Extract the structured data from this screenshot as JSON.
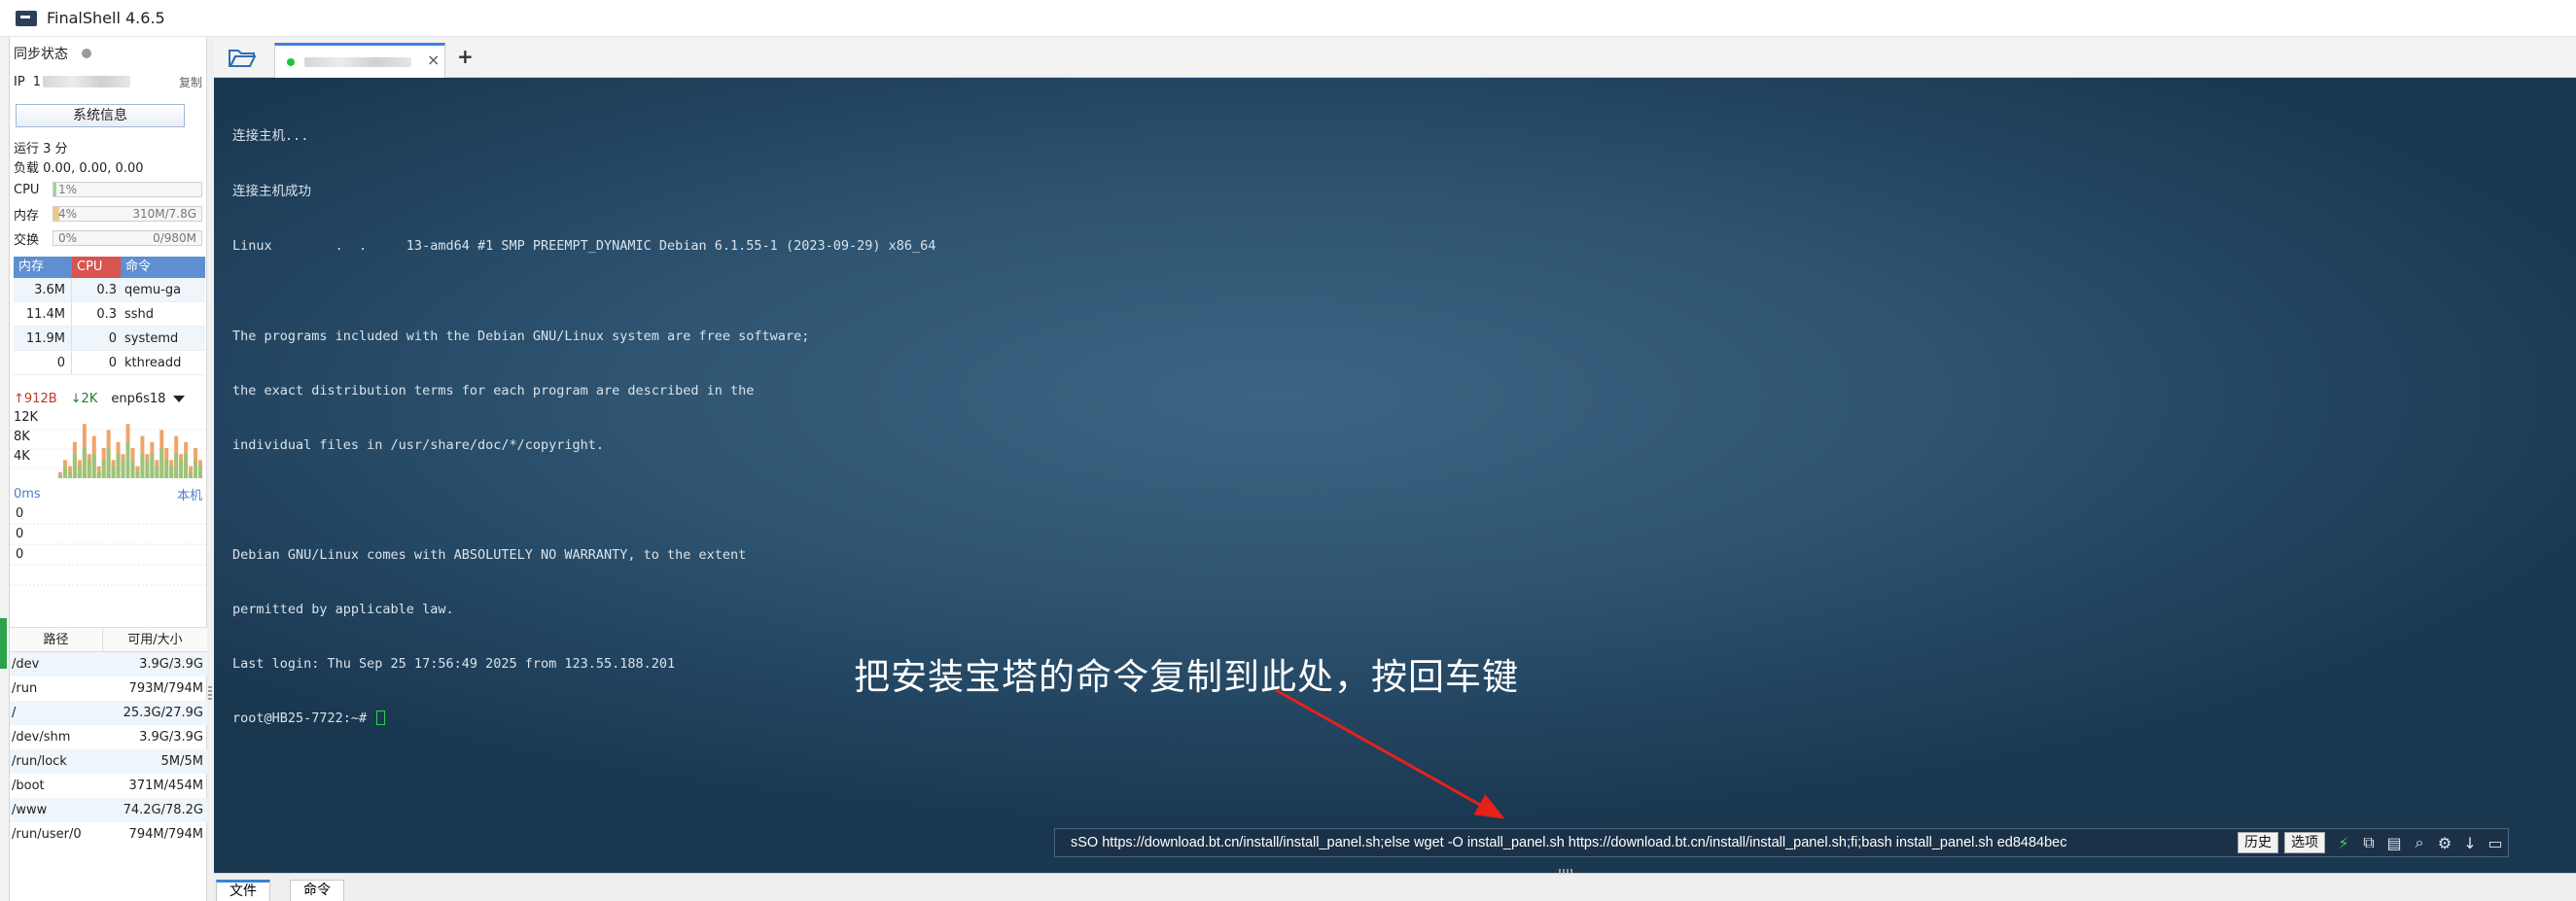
{
  "window": {
    "title": "FinalShell 4.6.5"
  },
  "sidebar": {
    "sync_label": "同步状态",
    "ip_label": "IP",
    "ip_value": "1",
    "copy_label": "复制",
    "sysinfo_button": "系统信息",
    "uptime": "运行 3 分",
    "load": "负载 0.00, 0.00, 0.00",
    "cpu": {
      "label": "CPU",
      "percent_text": "1%",
      "level": 0.01
    },
    "memory": {
      "label": "内存",
      "percent_text": "4%",
      "usage": "310M/7.8G",
      "level": 0.04
    },
    "swap": {
      "label": "交换",
      "percent_text": "0%",
      "usage": "0/980M",
      "level": 0.0
    },
    "process_headers": {
      "mem": "内存",
      "cpu": "CPU",
      "cmd": "命令"
    },
    "processes": [
      {
        "mem": "3.6M",
        "cpu": "0.3",
        "cmd": "qemu-ga"
      },
      {
        "mem": "11.4M",
        "cpu": "0.3",
        "cmd": "sshd"
      },
      {
        "mem": "11.9M",
        "cpu": "0",
        "cmd": "systemd"
      },
      {
        "mem": "0",
        "cpu": "0",
        "cmd": "kthreadd"
      }
    ],
    "network": {
      "up": "912B",
      "down": "2K",
      "interface": "enp6s18",
      "axis_labels": [
        "12K",
        "8K",
        "4K"
      ],
      "up_bars": [
        0.1,
        0.3,
        0.2,
        0.6,
        0.3,
        0.9,
        0.4,
        0.7,
        0.2,
        0.5,
        0.8,
        0.3,
        0.6,
        0.4,
        0.9,
        0.5,
        0.2,
        0.7,
        0.4,
        0.6,
        0.3,
        0.8,
        0.5,
        0.3,
        0.7,
        0.4,
        0.6,
        0.2,
        0.5,
        0.3
      ],
      "down_bars": [
        0.05,
        0.2,
        0.1,
        0.4,
        0.2,
        0.5,
        0.3,
        0.4,
        0.1,
        0.3,
        0.5,
        0.2,
        0.4,
        0.3,
        0.6,
        0.3,
        0.1,
        0.4,
        0.3,
        0.4,
        0.2,
        0.5,
        0.3,
        0.2,
        0.4,
        0.3,
        0.4,
        0.1,
        0.3,
        0.2
      ]
    },
    "ping": {
      "ms_label": "0ms",
      "local_label": "本机",
      "axis_labels": [
        "0",
        "0",
        "0"
      ]
    },
    "disk_headers": {
      "path": "路径",
      "size": "可用/大小"
    },
    "disks": [
      {
        "path": "/dev",
        "size": "3.9G/3.9G"
      },
      {
        "path": "/run",
        "size": "793M/794M"
      },
      {
        "path": "/",
        "size": "25.3G/27.9G"
      },
      {
        "path": "/dev/shm",
        "size": "3.9G/3.9G"
      },
      {
        "path": "/run/lock",
        "size": "5M/5M"
      },
      {
        "path": "/boot",
        "size": "371M/454M"
      },
      {
        "path": "/www",
        "size": "74.2G/78.2G"
      },
      {
        "path": "/run/user/0",
        "size": "794M/794M"
      }
    ]
  },
  "tabs": {
    "close_glyph": "×",
    "add_glyph": "+"
  },
  "terminal": {
    "lines": [
      "连接主机...",
      "连接主机成功",
      "Linux        .  .     13-amd64 #1 SMP PREEMPT_DYNAMIC Debian 6.1.55-1 (2023-09-29) x86_64",
      "",
      "The programs included with the Debian GNU/Linux system are free software;",
      "the exact distribution terms for each program are described in the",
      "individual files in /usr/share/doc/*/copyright.",
      "",
      "Debian GNU/Linux comes with ABSOLUTELY NO WARRANTY, to the extent",
      "permitted by applicable law.",
      "Last login: Thu Sep 25 17:56:49 2025 from 123.55.188.201"
    ],
    "prompt": "root@HB25-7722:~# ",
    "annotation": "把安装宝塔的命令复制到此处，按回车键",
    "annotation_arrow_color": "#e8201a"
  },
  "command_bar": {
    "value": "sSO https://download.bt.cn/install/install_panel.sh;else wget -O install_panel.sh https://download.bt.cn/install/install_panel.sh;fi;bash install_panel.sh ed8484bec",
    "history_button": "历史",
    "options_button": "选项"
  },
  "bottom_tabs": [
    "文件",
    "命令"
  ],
  "colors": {
    "accent_blue": "#3b83d6",
    "terminal_bg": "#2f5572",
    "cpu_red": "#d9534f",
    "online_green": "#23c23a"
  }
}
